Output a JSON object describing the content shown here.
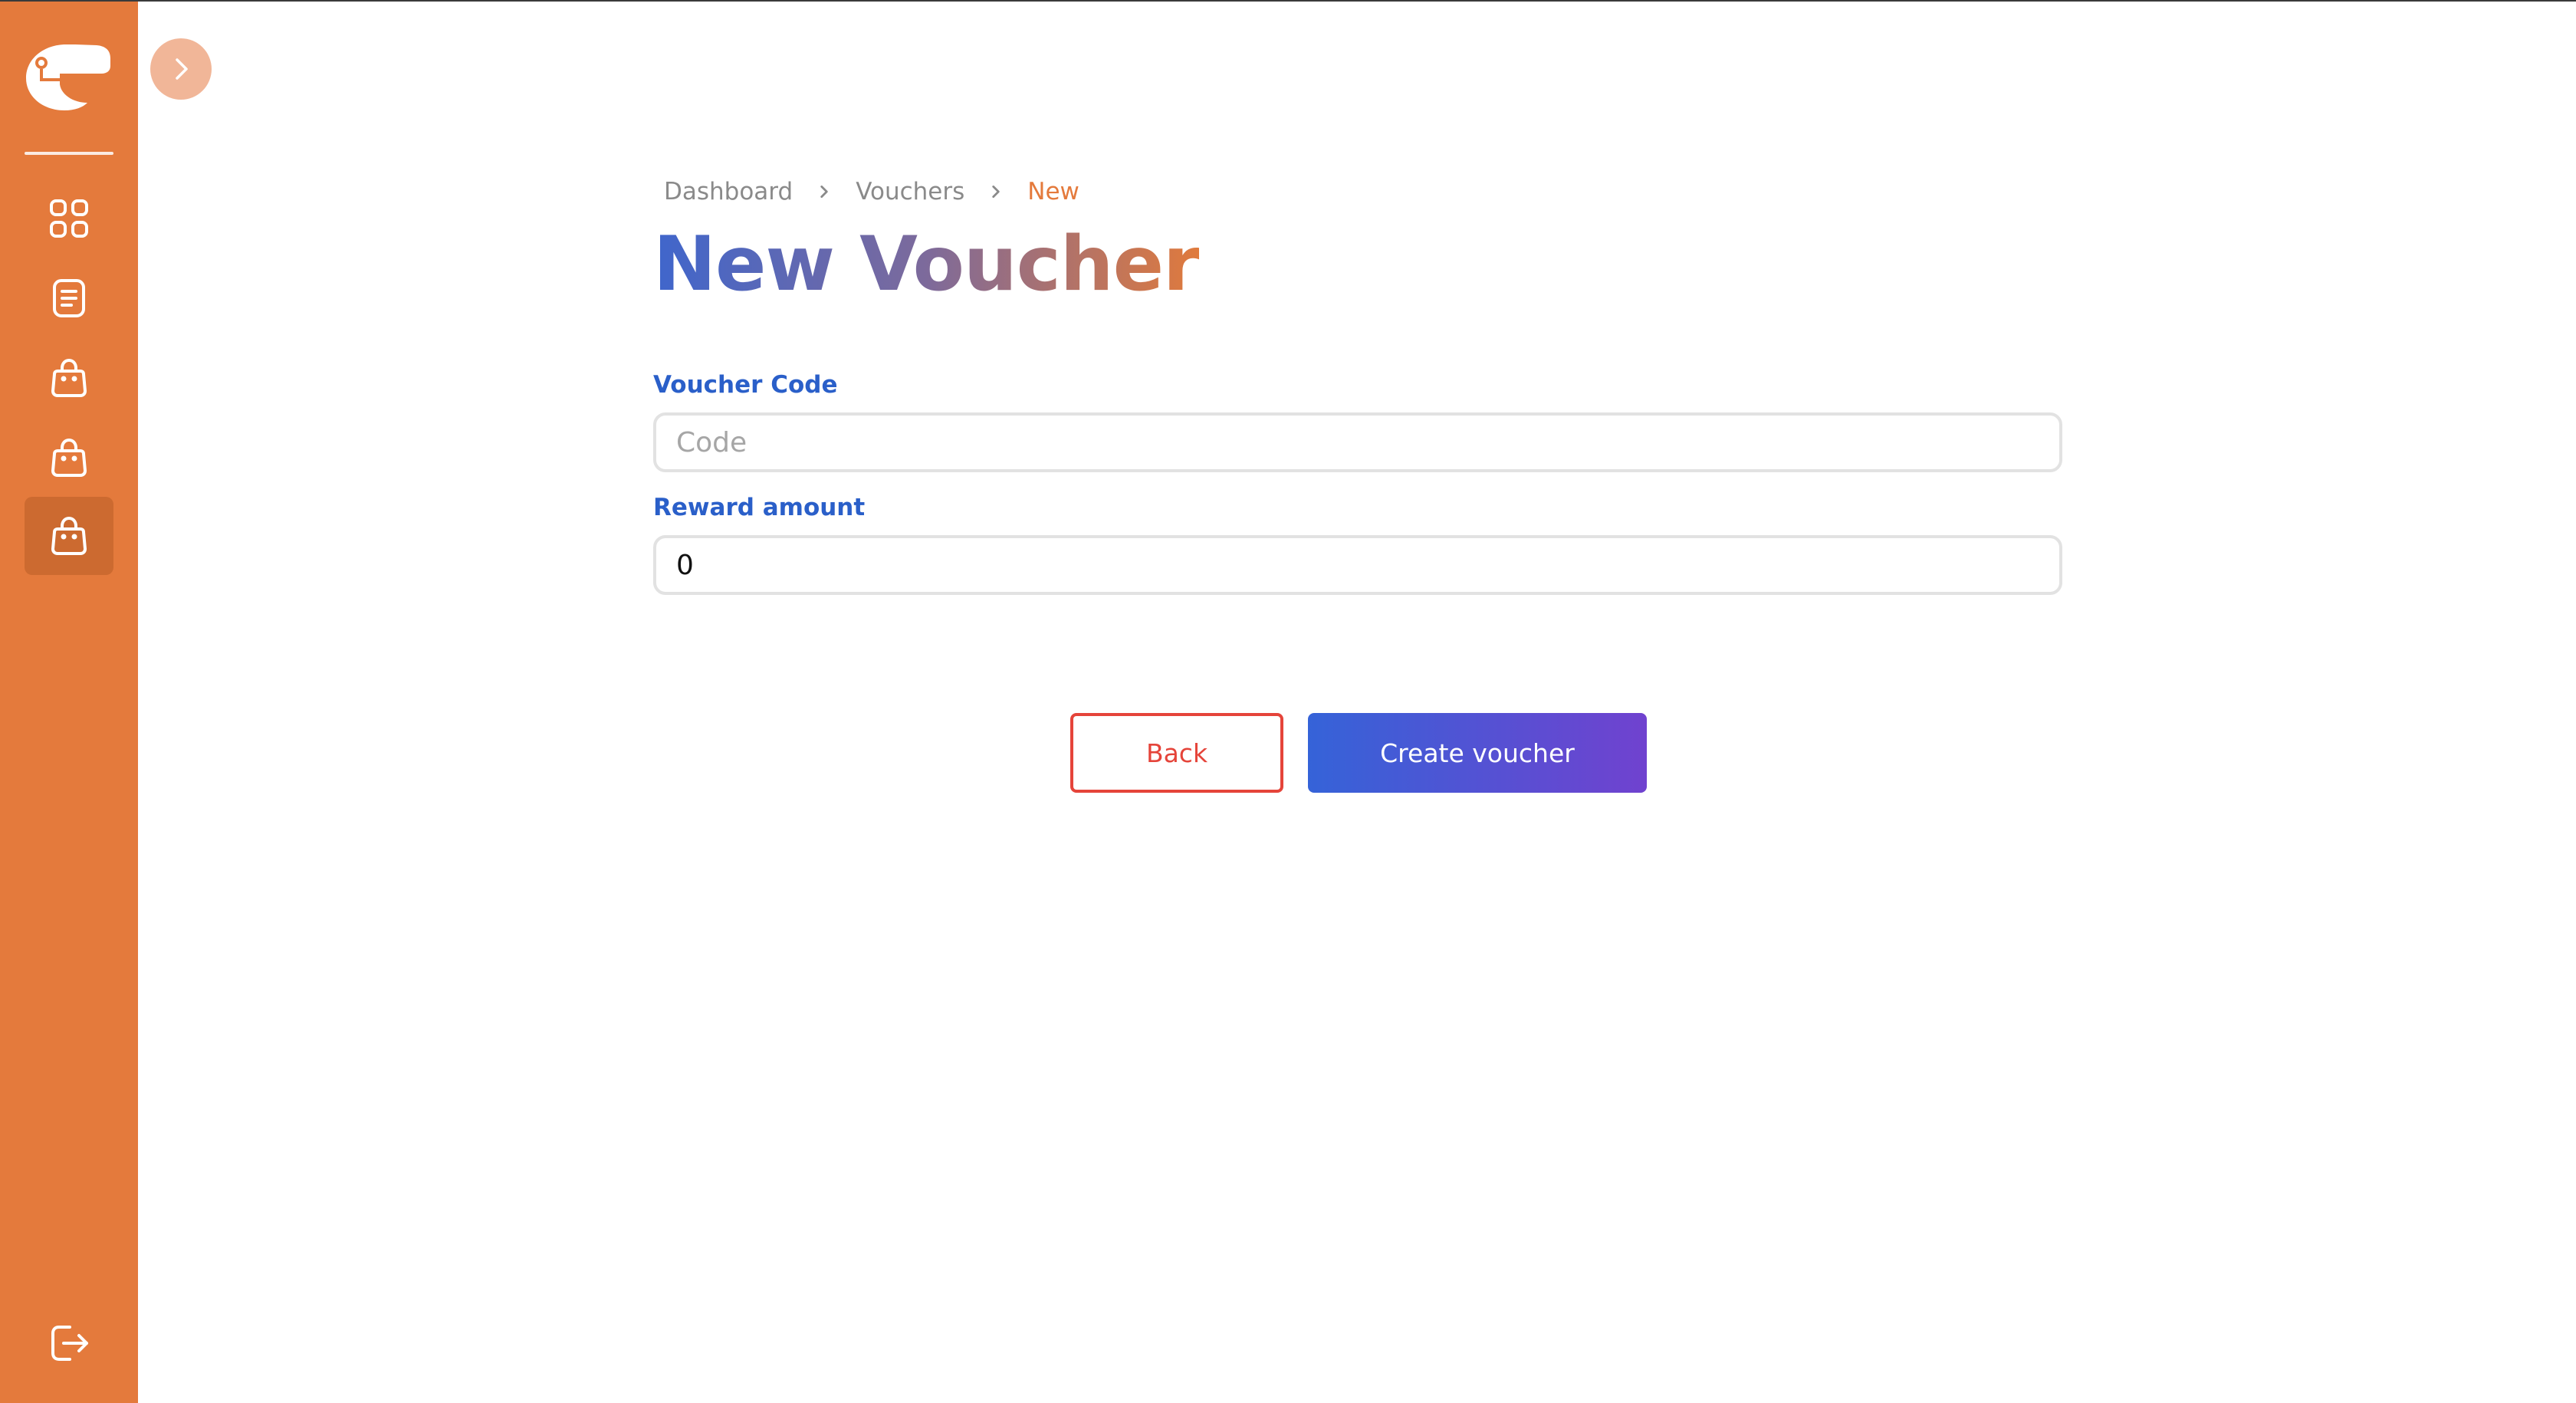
{
  "sidebar": {
    "items": [
      {
        "icon": "grid-icon",
        "active": false
      },
      {
        "icon": "document-icon",
        "active": false
      },
      {
        "icon": "shopping-bag-icon",
        "active": false
      },
      {
        "icon": "shopping-bag-icon",
        "active": false
      },
      {
        "icon": "shopping-bag-icon",
        "active": true
      }
    ],
    "logout_icon": "logout-icon",
    "toggle_icon": "chevron-right-icon"
  },
  "breadcrumb": {
    "items": [
      "Dashboard",
      "Vouchers"
    ],
    "current": "New"
  },
  "page": {
    "title": "New Voucher"
  },
  "form": {
    "voucher_code": {
      "label": "Voucher Code",
      "placeholder": "Code",
      "value": ""
    },
    "reward_amount": {
      "label": "Reward amount",
      "value": "0"
    }
  },
  "actions": {
    "back_label": "Back",
    "create_label": "Create voucher"
  },
  "colors": {
    "sidebar": "#e47a3c",
    "accent_blue": "#2a5fc9",
    "danger": "#e5443a"
  }
}
